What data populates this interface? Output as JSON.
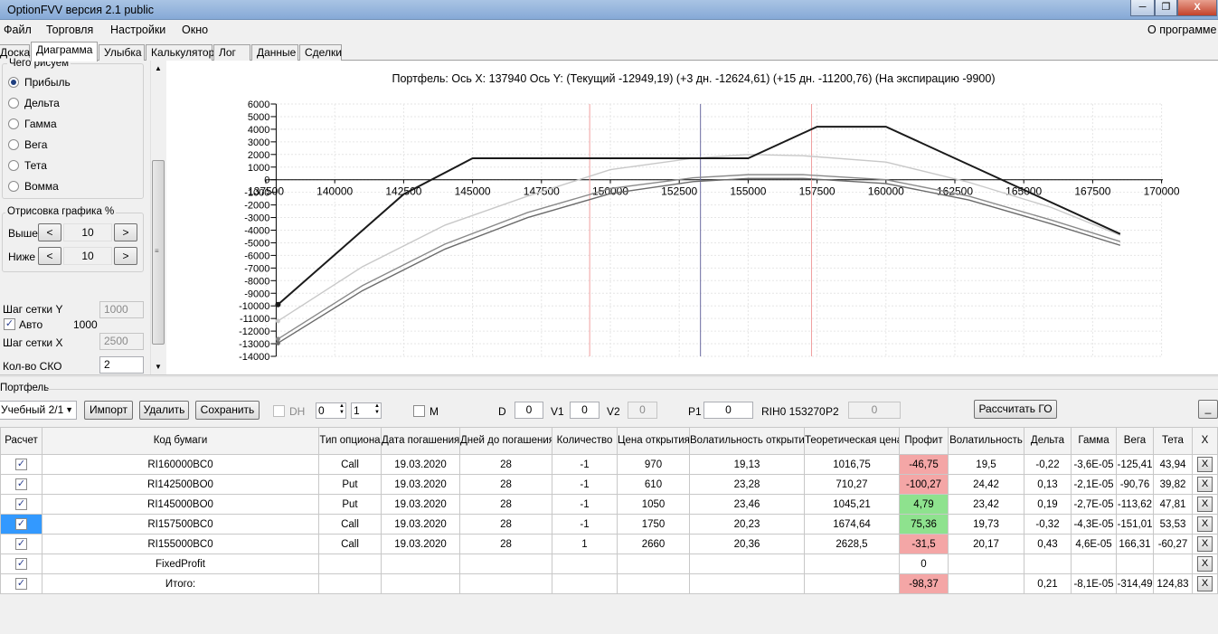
{
  "window": {
    "title": "OptionFVV версия 2.1 public",
    "minimize_glyph": "─",
    "restore_glyph": "❐",
    "close_glyph": "X"
  },
  "menu": {
    "items": [
      "Файл",
      "Торговля",
      "Настройки",
      "Окно"
    ],
    "about": "О программе"
  },
  "tabs": [
    "Доска",
    "Диаграмма",
    "Улыбка",
    "Калькулятор",
    "Лог",
    "Данные",
    "Сделки"
  ],
  "left": {
    "group1_title": "Чего рисуем",
    "radios": [
      {
        "label": "Прибыль",
        "checked": true
      },
      {
        "label": "Дельта",
        "checked": false
      },
      {
        "label": "Гамма",
        "checked": false
      },
      {
        "label": "Вега",
        "checked": false
      },
      {
        "label": "Тета",
        "checked": false
      },
      {
        "label": "Вомма",
        "checked": false
      }
    ],
    "group2_title": "Отрисовка графика %",
    "above_label": "Выше",
    "above_value": "10",
    "below_label": "Ниже",
    "below_value": "10",
    "btn_left": "<",
    "btn_right": ">",
    "grid_y_label": "Шаг сетки Y",
    "grid_y_value": "1000",
    "auto_label": "Авто",
    "auto_value": "1000",
    "grid_x_label": "Шаг сетки X",
    "grid_x_value": "2500",
    "sko_label": "Кол-во СКО",
    "sko_value": "2"
  },
  "chart_data": {
    "type": "line",
    "title": "Портфель: Ось X:  137940  Ось Y:  (Текущий  -12949,19)  (+3 дн.  -12624,61)  (+15 дн.  -11200,76)  (На экспирацию  -9900)",
    "xlim": [
      137500,
      170000
    ],
    "ylim": [
      -14000,
      6000
    ],
    "x_ticks": [
      137500,
      140000,
      142500,
      145000,
      147500,
      150000,
      152500,
      155000,
      157500,
      160000,
      162500,
      165000,
      167500,
      170000
    ],
    "y_ticks": [
      6000,
      5000,
      4000,
      3000,
      2000,
      1000,
      0,
      -1000,
      -2000,
      -3000,
      -4000,
      -5000,
      -6000,
      -7000,
      -8000,
      -9000,
      -10000,
      -11000,
      -12000,
      -13000,
      -14000
    ],
    "grid": true,
    "vertical_lines": [
      {
        "x": 149250,
        "color": "#f0a0a0"
      },
      {
        "x": 153270,
        "color": "#6a6aa0"
      },
      {
        "x": 157300,
        "color": "#f0a0a0"
      }
    ],
    "series": [
      {
        "color": "#1a1a1a",
        "x": [
          137940,
          142500,
          145000,
          150000,
          155000,
          157500,
          160000,
          162500,
          165000,
          168500
        ],
        "y": [
          -9900,
          -1150,
          1700,
          1700,
          1700,
          4200,
          4200,
          1700,
          -800,
          -4300
        ]
      },
      {
        "color": "#c8c8c8",
        "x": [
          137940,
          141000,
          144000,
          147000,
          150000,
          153000,
          155000,
          157000,
          160000,
          163000,
          166000,
          168500
        ],
        "y": [
          -11200,
          -6900,
          -3600,
          -1300,
          800,
          1700,
          2000,
          1900,
          1400,
          -200,
          -2200,
          -4400
        ]
      },
      {
        "color": "#8a8a8a",
        "x": [
          137940,
          141000,
          144000,
          147000,
          150000,
          153000,
          155000,
          157000,
          160000,
          163000,
          166000,
          168500
        ],
        "y": [
          -12625,
          -8400,
          -5100,
          -2600,
          -700,
          150,
          400,
          400,
          0,
          -1300,
          -3200,
          -4900
        ]
      },
      {
        "color": "#6a6a6a",
        "x": [
          137940,
          141000,
          144000,
          147000,
          150000,
          153000,
          155000,
          157000,
          160000,
          163000,
          166000,
          168500
        ],
        "y": [
          -12949,
          -8800,
          -5500,
          -3000,
          -1100,
          -150,
          100,
          100,
          -300,
          -1600,
          -3500,
          -5200
        ]
      }
    ]
  },
  "portfolio": {
    "title": "Портфель",
    "selector": "Учебный 2/1",
    "import": "Импорт",
    "delete": "Удалить",
    "save": "Сохранить",
    "dh": "DH",
    "spin1": "0",
    "spin2": "1",
    "m": "M",
    "d_label": "D",
    "d_value": "0",
    "v1_label": "V1",
    "v1_value": "0",
    "v2_label": "V2",
    "v2_value": "0",
    "p1_label": "P1",
    "p1_value": "0",
    "rih": "RIH0 153270",
    "p2_label": "P2",
    "p2_value": "0",
    "calc_go": "Рассчитать ГО",
    "collapse": "_",
    "columns": [
      "Расчет",
      "Код бумаги",
      "Тип опциона",
      "Дата погашения",
      "Дней до погашения",
      "Количество",
      "Цена открытия",
      "Волатильность открытия",
      "Теоретическая цена",
      "Профит",
      "Волатильность",
      "Дельта",
      "Гамма",
      "Вега",
      "Тета",
      "X"
    ],
    "rows": [
      {
        "code": "RI160000BC0",
        "type": "Call",
        "date": "19.03.2020",
        "days": "28",
        "qty": "-1",
        "price": "970",
        "vol_open": "19,13",
        "theo": "1016,75",
        "profit": "-46,75",
        "profit_color": "red",
        "vol": "19,5",
        "delta": "-0,22",
        "gamma": "-3,6E-05",
        "vega": "-125,41",
        "theta": "43,94",
        "sel": false
      },
      {
        "code": "RI142500BO0",
        "type": "Put",
        "date": "19.03.2020",
        "days": "28",
        "qty": "-1",
        "price": "610",
        "vol_open": "23,28",
        "theo": "710,27",
        "profit": "-100,27",
        "profit_color": "red",
        "vol": "24,42",
        "delta": "0,13",
        "gamma": "-2,1E-05",
        "vega": "-90,76",
        "theta": "39,82",
        "sel": false
      },
      {
        "code": "RI145000BO0",
        "type": "Put",
        "date": "19.03.2020",
        "days": "28",
        "qty": "-1",
        "price": "1050",
        "vol_open": "23,46",
        "theo": "1045,21",
        "profit": "4,79",
        "profit_color": "green",
        "vol": "23,42",
        "delta": "0,19",
        "gamma": "-2,7E-05",
        "vega": "-113,62",
        "theta": "47,81",
        "sel": false
      },
      {
        "code": "RI157500BC0",
        "type": "Call",
        "date": "19.03.2020",
        "days": "28",
        "qty": "-1",
        "price": "1750",
        "vol_open": "20,23",
        "theo": "1674,64",
        "profit": "75,36",
        "profit_color": "green",
        "vol": "19,73",
        "delta": "-0,32",
        "gamma": "-4,3E-05",
        "vega": "-151,01",
        "theta": "53,53",
        "sel": true
      },
      {
        "code": "RI155000BC0",
        "type": "Call",
        "date": "19.03.2020",
        "days": "28",
        "qty": "1",
        "price": "2660",
        "vol_open": "20,36",
        "theo": "2628,5",
        "profit": "-31,5",
        "profit_color": "red",
        "vol": "20,17",
        "delta": "0,43",
        "gamma": "4,6E-05",
        "vega": "166,31",
        "theta": "-60,27",
        "sel": false
      },
      {
        "code": "FixedProfit",
        "type": "",
        "date": "",
        "days": "",
        "qty": "",
        "price": "",
        "vol_open": "",
        "theo": "",
        "profit": "0",
        "profit_color": "",
        "vol": "",
        "delta": "",
        "gamma": "",
        "vega": "",
        "theta": "",
        "sel": false
      },
      {
        "code": "Итого:",
        "type": "",
        "date": "",
        "days": "",
        "qty": "",
        "price": "",
        "vol_open": "",
        "theo": "",
        "profit": "-98,37",
        "profit_color": "red",
        "vol": "",
        "delta": "0,21",
        "gamma": "-8,1E-05",
        "vega": "-314,49",
        "theta": "124,83",
        "sel": false
      }
    ]
  }
}
